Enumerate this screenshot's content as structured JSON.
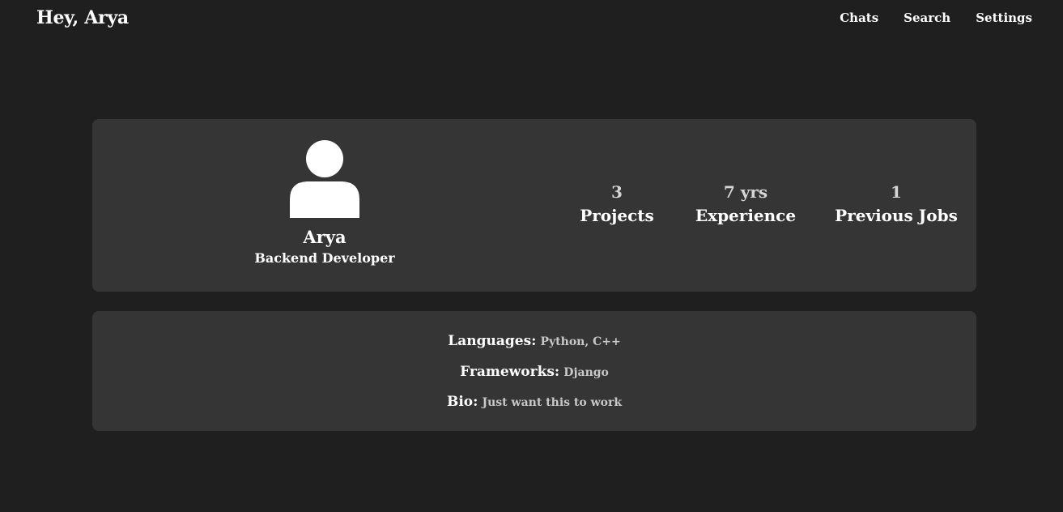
{
  "header": {
    "greeting": "Hey, Arya",
    "nav": [
      {
        "label": "Chats"
      },
      {
        "label": "Search"
      },
      {
        "label": "Settings"
      }
    ]
  },
  "profile": {
    "avatar_icon": "user-icon",
    "name": "Arya",
    "role": "Backend Developer",
    "stats": [
      {
        "value": "3",
        "label": "Projects"
      },
      {
        "value": "7 yrs",
        "label": "Experience"
      },
      {
        "value": "1",
        "label": "Previous Jobs"
      }
    ]
  },
  "details": {
    "languages_label": "Languages:",
    "languages_value": "Python, C++",
    "frameworks_label": "Frameworks:",
    "frameworks_value": "Django",
    "bio_label": "Bio:",
    "bio_value": "Just want this to work"
  },
  "colors": {
    "background": "#1f1f1f",
    "card": "#353535",
    "text": "#ffffff",
    "muted": "#c8c8c8"
  }
}
